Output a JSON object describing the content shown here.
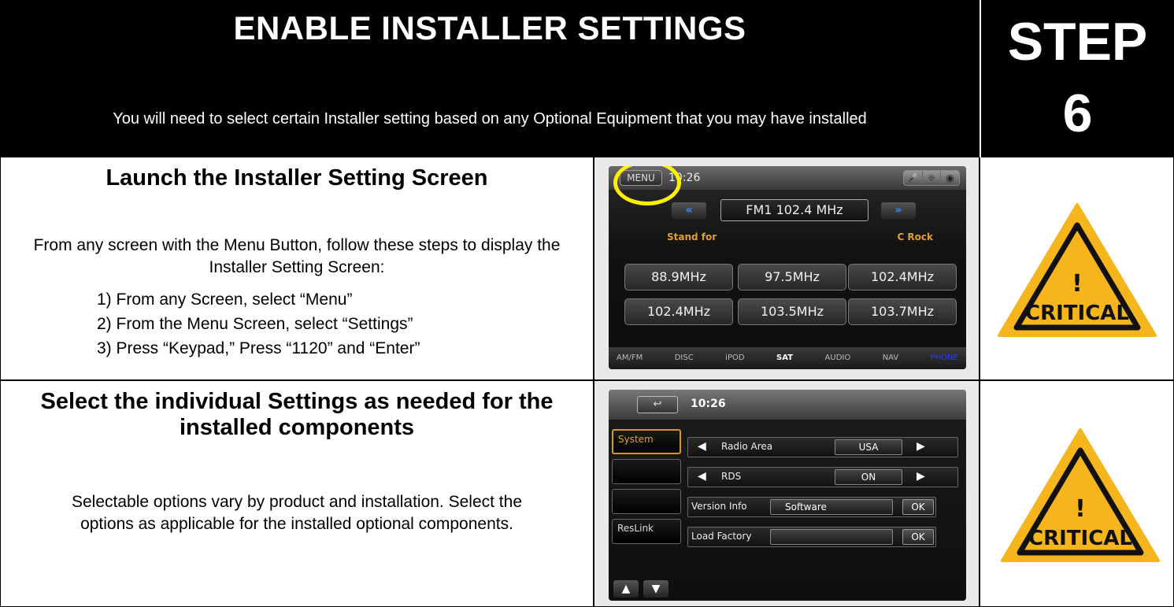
{
  "header": {
    "title": "ENABLE INSTALLER SETTINGS",
    "subtitle": "You will need to select certain Installer setting based on any Optional Equipment that you may have installed",
    "step_label": "STEP",
    "step_number": "6"
  },
  "section1": {
    "title": "Launch the Installer Setting Screen",
    "intro": "From any screen with the Menu Button, follow these steps to display the Installer Setting Screen:",
    "steps": [
      "1)  From any Screen, select “Menu”",
      "2)  From the Menu Screen, select “Settings”",
      "3)  Press “Keypad,” Press “1120” and “Enter”"
    ],
    "warning_text": "CRITICAL",
    "warning_mark": "!"
  },
  "section2": {
    "title": "Select the individual Settings as needed for the installed components",
    "body": "Selectable options vary by product and installation. Select the options as applicable for the installed optional components.",
    "warning_text": "CRITICAL",
    "warning_mark": "!"
  },
  "radio_screen": {
    "menu_label": "MENU",
    "time": "10:26",
    "seek_left": "«",
    "seek_right": "»",
    "band_freq": "FM1  102.4   MHz",
    "station_left": "Stand for",
    "station_right": "C Rock",
    "presets": [
      "88.9MHz",
      "97.5MHz",
      "102.4MHz",
      "102.4MHz",
      "103.5MHz",
      "103.7MHz"
    ],
    "sources": [
      "AM/FM",
      "DISC",
      "iPOD",
      "SAT",
      "AUDIO",
      "NAV",
      "PHONE"
    ],
    "active_source": "SAT"
  },
  "settings_screen": {
    "time": "10:26",
    "back_icon": "↩",
    "side_items": [
      "System",
      "",
      "",
      "ResLink"
    ],
    "radio_area_label": "Radio Area",
    "radio_area_value": "USA",
    "rds_label": "RDS",
    "rds_value": "ON",
    "version_label": "Version Info",
    "version_value": "Software",
    "version_ok": "OK",
    "factory_label": "Load Factory",
    "factory_ok": "OK"
  },
  "colors": {
    "warning_fill": "#f6b51c",
    "highlight_ring": "#ffef00",
    "station_text": "#e0a030"
  }
}
